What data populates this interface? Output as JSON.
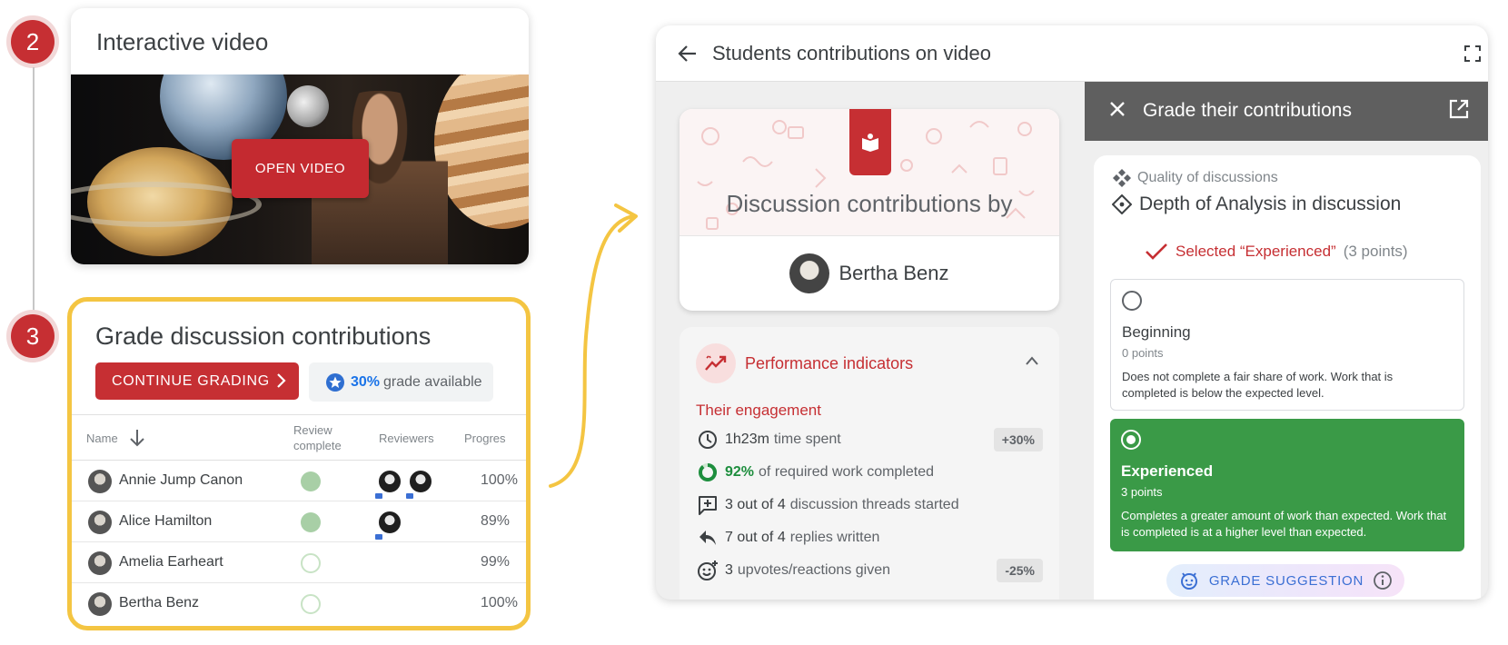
{
  "steps": {
    "step2": "2",
    "step3": "3"
  },
  "video_card": {
    "title": "Interactive video",
    "open_button": "OPEN VIDEO"
  },
  "grade_card": {
    "title": "Grade discussion contributions",
    "continue_button": "CONTINUE GRADING",
    "grade_percent": "30%",
    "grade_text": "grade available",
    "columns": {
      "name": "Name",
      "review_complete_line1": "Review",
      "review_complete_line2": "complete",
      "reviewers": "Reviewers",
      "progress": "Progres"
    },
    "rows": [
      {
        "name": "Annie Jump Canon",
        "review_complete": true,
        "reviewers": 2,
        "progress": "100%"
      },
      {
        "name": "Alice Hamilton",
        "review_complete": true,
        "reviewers": 1,
        "progress": "89%"
      },
      {
        "name": "Amelia Earheart",
        "review_complete": false,
        "reviewers": 0,
        "progress": "99%"
      },
      {
        "name": "Bertha Benz",
        "review_complete": false,
        "reviewers": 0,
        "progress": "100%"
      }
    ]
  },
  "panel": {
    "title": "Students contributions on video",
    "discussion": {
      "title": "Discussion contributions by",
      "student": "Bertha Benz"
    },
    "performance": {
      "title": "Performance indicators",
      "engagement_title": "Their engagement",
      "indicators": [
        {
          "value": "1h23m",
          "text": "time spent",
          "tag": "+30%",
          "icon": "clock-icon"
        },
        {
          "value": "92%",
          "text": "of required work completed",
          "tag": "",
          "icon": "progress-ring-icon"
        },
        {
          "value": "3 out of 4",
          "text": "discussion threads started",
          "tag": "",
          "icon": "add-comment-icon"
        },
        {
          "value": "7 out of 4",
          "text": "replies written",
          "tag": "",
          "icon": "reply-icon"
        },
        {
          "value": "3",
          "text": "upvotes/reactions given",
          "tag": "-25%",
          "icon": "add-reaction-icon"
        }
      ]
    },
    "grading": {
      "title": "Grade their contributions",
      "criterion_group": "Quality of discussions",
      "criterion": "Depth of Analysis in discussion",
      "selected_text": "Selected “Experienced”",
      "selected_points": "(3 points)",
      "options": [
        {
          "title": "Beginning",
          "points": "0 points",
          "description": "Does not complete a fair share of work. Work that is completed is below the expected level.",
          "selected": false
        },
        {
          "title": "Experienced",
          "points": "3 points",
          "description": "Completes a greater amount of work than expected. Work that is completed is at a higher level than expected.",
          "selected": true
        }
      ],
      "suggestion_label": "GRADE SUGGESTION"
    }
  },
  "colors": {
    "brand_red": "#c62f33",
    "highlight_yellow": "#f4c542",
    "success_green": "#3a9a47",
    "link_blue": "#1a73e8"
  }
}
